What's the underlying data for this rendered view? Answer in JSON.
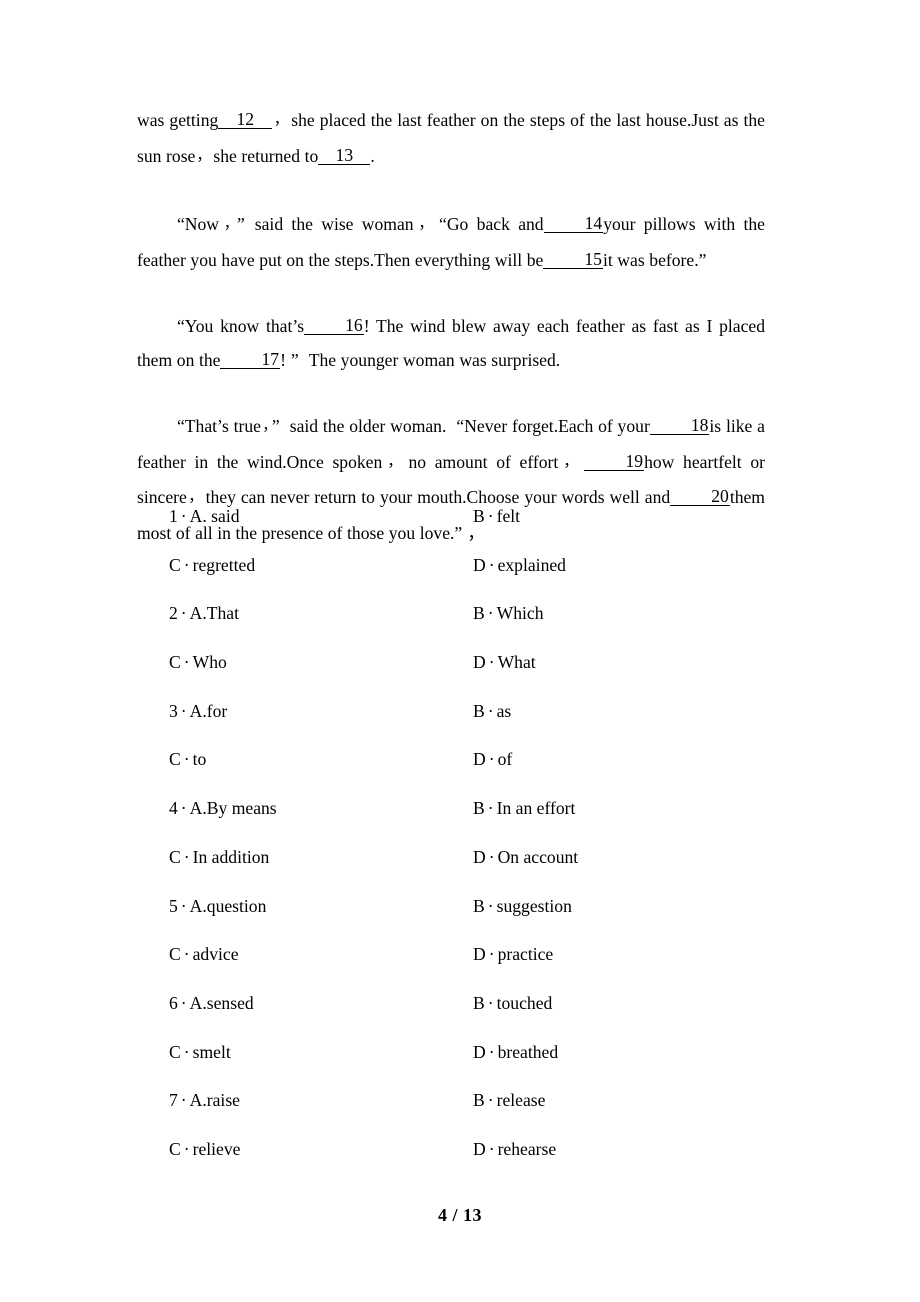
{
  "document": {
    "background_color": "#ffffff",
    "text_color": "#000000",
    "page_footer": "4 / 13"
  },
  "passage": {
    "paragraphs": [
      {
        "id": "p1",
        "indent": false,
        "segments": [
          {
            "type": "text",
            "value": "was getting"
          },
          {
            "type": "blank",
            "value": "12"
          },
          {
            "type": "comma",
            "value": "，"
          },
          {
            "type": "text",
            "value": "she placed the last feather on the steps of the last house.Just as the sun rose"
          },
          {
            "type": "comma",
            "value": "，"
          },
          {
            "type": "text",
            "value": "she returned to"
          },
          {
            "type": "blank",
            "value": "13"
          },
          {
            "type": "text",
            "value": "."
          }
        ],
        "plain": "was getting__12__，she placed the last feather on the steps of the last house.Just as the sun rose，she returned to__13__."
      },
      {
        "id": "p2",
        "indent": true,
        "segments": [
          {
            "type": "text",
            "value": "“Now"
          },
          {
            "type": "comma",
            "value": "，"
          },
          {
            "type": "text",
            "value": "”"
          },
          {
            "type": "text",
            "value": "said the wise woman"
          },
          {
            "type": "comma",
            "value": "，"
          },
          {
            "type": "text",
            "value": "“Go back and"
          },
          {
            "type": "blank",
            "value": "14"
          },
          {
            "type": "text",
            "value": "your pillows with the feather you have put on the steps.Then everything will be"
          },
          {
            "type": "blank",
            "value": "15"
          },
          {
            "type": "text",
            "value": "it was before.”"
          }
        ],
        "plain": "“Now，” said the wise woman，“Go back and__14__your pillows with the feather you have put on the steps.Then everything will be__15__it was before.”"
      },
      {
        "id": "p3",
        "indent": true,
        "segments": [
          {
            "type": "text",
            "value": "“You know that’s"
          },
          {
            "type": "blank",
            "value": "16"
          },
          {
            "type": "text",
            "value": "! The wind blew away each feather as fast as I placed them on the"
          },
          {
            "type": "blank",
            "value": "17"
          },
          {
            "type": "text",
            "value": "!"
          },
          {
            "type": "text",
            "value": "”"
          },
          {
            "type": "text",
            "value": "The younger woman was surprised."
          }
        ],
        "plain": "“You know that’s__16__! The wind blew away each feather as fast as I placed them on the__17__!” The younger woman was surprised."
      },
      {
        "id": "p4",
        "indent": true,
        "segments": [
          {
            "type": "text",
            "value": "“That’s true"
          },
          {
            "type": "comma",
            "value": "，"
          },
          {
            "type": "text",
            "value": "”"
          },
          {
            "type": "text",
            "value": "said the older woman."
          },
          {
            "type": "text",
            "value": "“Never forget.Each of your"
          },
          {
            "type": "blank",
            "value": "18"
          },
          {
            "type": "text",
            "value": "is like a feather in the wind.Once spoken"
          },
          {
            "type": "comma",
            "value": "，"
          },
          {
            "type": "text",
            "value": "no amount of effort"
          },
          {
            "type": "comma",
            "value": "，"
          },
          {
            "type": "blank",
            "value": "19"
          },
          {
            "type": "text",
            "value": "how heartfelt or sincere"
          },
          {
            "type": "comma",
            "value": "，"
          },
          {
            "type": "text",
            "value": "they can never return to your mouth.Choose your words well and"
          },
          {
            "type": "blank",
            "value": "20"
          },
          {
            "type": "text",
            "value": "them most of all in the presence of those you love.”"
          },
          {
            "type": "text",
            "value": "，"
          }
        ],
        "plain": "“That’s true，” said the older woman. “Never forget.Each of your__18__is like a feather in the wind.Once spoken，no amount of effort，__19__how heartfelt or sincere，they can never return to your mouth.Choose your words well and__20__them most of all in the presence of those you love.”，"
      }
    ]
  },
  "questions": [
    {
      "number": "1",
      "rows": [
        {
          "left": {
            "letter": "A.",
            "text": " said",
            "joiner": "·"
          },
          "right": {
            "letter": "B",
            "text": "felt",
            "joiner": "·"
          }
        },
        {
          "left": {
            "letter": "C",
            "text": "regretted",
            "joiner": "·"
          },
          "right": {
            "letter": "D",
            "text": "explained",
            "joiner": "·"
          }
        }
      ]
    },
    {
      "number": "2",
      "rows": [
        {
          "left": {
            "letter": "A.",
            "text": "That",
            "joiner": "·"
          },
          "right": {
            "letter": "B",
            "text": "Which",
            "joiner": "·"
          }
        },
        {
          "left": {
            "letter": "C",
            "text": "Who",
            "joiner": "·"
          },
          "right": {
            "letter": "D",
            "text": "What",
            "joiner": "·"
          }
        }
      ]
    },
    {
      "number": "3",
      "rows": [
        {
          "left": {
            "letter": "A.",
            "text": "for",
            "joiner": "·"
          },
          "right": {
            "letter": "B",
            "text": "as",
            "joiner": "·"
          }
        },
        {
          "left": {
            "letter": "C",
            "text": "to",
            "joiner": "·"
          },
          "right": {
            "letter": "D",
            "text": "of",
            "joiner": "·"
          }
        }
      ]
    },
    {
      "number": "4",
      "rows": [
        {
          "left": {
            "letter": "A.",
            "text": "By means",
            "joiner": "·"
          },
          "right": {
            "letter": "B",
            "text": "In an effort",
            "joiner": "·"
          }
        },
        {
          "left": {
            "letter": "C",
            "text": "In addition",
            "joiner": "·"
          },
          "right": {
            "letter": "D",
            "text": "On account",
            "joiner": "·"
          }
        }
      ]
    },
    {
      "number": "5",
      "rows": [
        {
          "left": {
            "letter": "A.",
            "text": "question",
            "joiner": "·"
          },
          "right": {
            "letter": "B",
            "text": "suggestion",
            "joiner": "·"
          }
        },
        {
          "left": {
            "letter": "C",
            "text": "advice",
            "joiner": "·"
          },
          "right": {
            "letter": "D",
            "text": "practice",
            "joiner": "·"
          }
        }
      ]
    },
    {
      "number": "6",
      "rows": [
        {
          "left": {
            "letter": "A.",
            "text": "sensed",
            "joiner": "·"
          },
          "right": {
            "letter": "B",
            "text": "touched",
            "joiner": "·"
          }
        },
        {
          "left": {
            "letter": "C",
            "text": "smelt",
            "joiner": "·"
          },
          "right": {
            "letter": "D",
            "text": "breathed",
            "joiner": "·"
          }
        }
      ]
    },
    {
      "number": "7",
      "rows": [
        {
          "left": {
            "letter": "A.",
            "text": "raise",
            "joiner": "·"
          },
          "right": {
            "letter": "B",
            "text": "release",
            "joiner": "·"
          }
        },
        {
          "left": {
            "letter": "C",
            "text": "relieve",
            "joiner": "·"
          },
          "right": {
            "letter": "D",
            "text": "rehearse",
            "joiner": "·"
          }
        }
      ]
    }
  ],
  "flat_options": [
    {
      "row": 0,
      "left": "1 · A. said",
      "right": "B · felt"
    },
    {
      "row": 1,
      "left": "C · regretted",
      "right": "D · explained"
    },
    {
      "row": 2,
      "left": "2 · A.That",
      "right": "B · Which"
    },
    {
      "row": 3,
      "left": "C · Who",
      "right": "D · What"
    },
    {
      "row": 4,
      "left": "3 · A.for",
      "right": "B · as"
    },
    {
      "row": 5,
      "left": "C · to",
      "right": "D · of"
    },
    {
      "row": 6,
      "left": "4 · A.By means",
      "right": "B · In an effort"
    },
    {
      "row": 7,
      "left": "C · In addition",
      "right": "D · On account"
    },
    {
      "row": 8,
      "left": "5 · A.question",
      "right": "B · suggestion"
    },
    {
      "row": 9,
      "left": "C · advice",
      "right": "D · practice"
    },
    {
      "row": 10,
      "left": "6 · A.sensed",
      "right": "B · touched"
    },
    {
      "row": 11,
      "left": "C · smelt",
      "right": "D · breathed"
    },
    {
      "row": 12,
      "left": "7 · A.raise",
      "right": "B · release"
    },
    {
      "row": 13,
      "left": "C · relieve",
      "right": "D · rehearse"
    }
  ],
  "blanks": [
    "12",
    "13",
    "14",
    "15",
    "16",
    "17",
    "18",
    "19",
    "20"
  ]
}
